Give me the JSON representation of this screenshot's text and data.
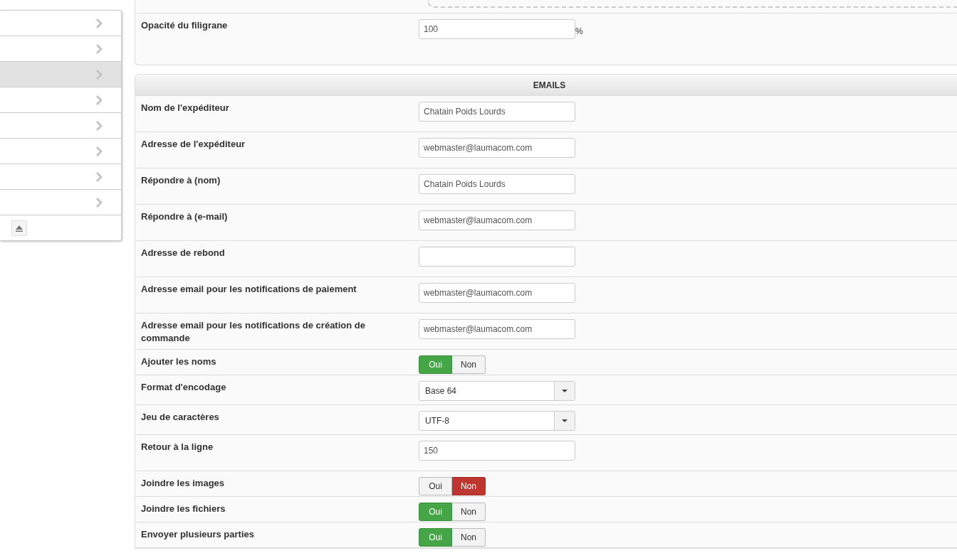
{
  "sidebar": {
    "items": [
      {
        "selected": false
      },
      {
        "selected": false
      },
      {
        "selected": true
      },
      {
        "selected": false
      },
      {
        "selected": false
      },
      {
        "selected": false
      },
      {
        "selected": false
      },
      {
        "selected": false
      }
    ]
  },
  "watermark_panel": {
    "rows": [
      {
        "kind": "text",
        "label": "Opacité du filigrane",
        "value": "100",
        "unit": "%"
      }
    ]
  },
  "emails_panel": {
    "title": "EMAILS",
    "rows": [
      {
        "kind": "text",
        "label": "Nom de l'expéditeur",
        "value": "Chatain Poids Lourds"
      },
      {
        "kind": "text",
        "label": "Adresse de l'expéditeur",
        "value": "webmaster@laumacom.com"
      },
      {
        "kind": "text",
        "label": "Répondre à (nom)",
        "value": "Chatain Poids Lourds"
      },
      {
        "kind": "text",
        "label": "Répondre à (e-mail)",
        "value": "webmaster@laumacom.com"
      },
      {
        "kind": "text",
        "label": "Adresse de rebond"
      },
      {
        "kind": "text",
        "label": "Adresse email pour les notifications de paiement",
        "value": "webmaster@laumacom.com"
      },
      {
        "kind": "text",
        "label": "Adresse email pour les notifications de création de commande",
        "value": "webmaster@laumacom.com"
      },
      {
        "kind": "toggle",
        "label": "Ajouter les noms",
        "options": [
          {
            "label": "Oui",
            "selected": true
          },
          {
            "label": "Non",
            "selected": false
          }
        ]
      },
      {
        "kind": "select",
        "label": "Format d'encodage",
        "value": "Base 64"
      },
      {
        "kind": "select",
        "label": "Jeu de caractères",
        "value": "UTF-8"
      },
      {
        "kind": "text",
        "label": "Retour à la ligne",
        "value": "150"
      },
      {
        "kind": "toggle",
        "label": "Joindre les images",
        "options": [
          {
            "label": "Oui",
            "selected": false
          },
          {
            "label": "Non",
            "selected": true
          }
        ]
      },
      {
        "kind": "toggle",
        "label": "Joindre les fichiers",
        "options": [
          {
            "label": "Oui",
            "selected": true
          },
          {
            "label": "Non",
            "selected": false
          }
        ]
      },
      {
        "kind": "toggle",
        "label": "Envoyer plusieurs parties",
        "options": [
          {
            "label": "Oui",
            "selected": true
          },
          {
            "label": "Non",
            "selected": false
          }
        ]
      }
    ]
  }
}
